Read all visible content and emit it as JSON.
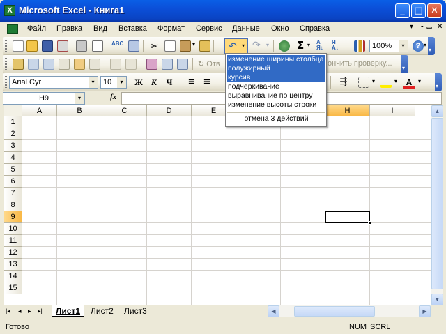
{
  "window": {
    "title": "Microsoft Excel - Книга1",
    "icon_label": "X",
    "minimize": "_",
    "maximize": "□",
    "close": "✕"
  },
  "menu": {
    "items": [
      "Файл",
      "Правка",
      "Вид",
      "Вставка",
      "Формат",
      "Сервис",
      "Данные",
      "Окно",
      "Справка"
    ],
    "doc_controls": [
      "▾",
      "-",
      "ꟷ",
      "✕"
    ]
  },
  "standard_toolbar": {
    "zoom": "100%",
    "icons": [
      "new-icon",
      "open-icon",
      "save-icon",
      "permission-icon",
      "print-icon",
      "print-preview-icon",
      "spelling-icon",
      "research-icon",
      "cut-icon",
      "copy-icon",
      "paste-icon",
      "format-painter-icon",
      "undo-icon",
      "redo-icon",
      "hyperlink-icon",
      "autosum-icon",
      "sort-ascending-icon",
      "sort-descending-icon",
      "chart-wizard-icon",
      "help-icon"
    ],
    "autosum": "Σ"
  },
  "reviewing_toolbar": {
    "reply_label": "Отв",
    "end_review_label": "ончить проверку..."
  },
  "formatting_toolbar": {
    "font": "Arial Cyr",
    "size": "10",
    "bold": "Ж",
    "italic": "К",
    "underline": "Ч"
  },
  "formula_bar": {
    "name_box": "H9",
    "fx": "fx",
    "formula": ""
  },
  "grid": {
    "columns": [
      "A",
      "B",
      "C",
      "D",
      "E",
      "F",
      "G",
      "H",
      "I"
    ],
    "rows": [
      "1",
      "2",
      "3",
      "4",
      "5",
      "6",
      "7",
      "8",
      "9",
      "10",
      "11",
      "12",
      "13",
      "14",
      "15"
    ],
    "selected_column": "H",
    "selected_row": "9"
  },
  "undo_dropdown": {
    "items": [
      {
        "label": "изменение ширины столбца",
        "selected": true
      },
      {
        "label": "полужирный",
        "selected": true
      },
      {
        "label": "курсив",
        "selected": true
      },
      {
        "label": "подчеркивание",
        "selected": false
      },
      {
        "label": "выравнивание по центру",
        "selected": false
      },
      {
        "label": "изменение высоты строки",
        "selected": false
      }
    ],
    "footer": "отмена 3 действий"
  },
  "sheets": {
    "tabs": [
      "Лист1",
      "Лист2",
      "Лист3"
    ],
    "active": "Лист1",
    "nav": [
      "|◂",
      "◂",
      "▸",
      "▸|"
    ]
  },
  "status_bar": {
    "status": "Готово",
    "num": "NUM",
    "scrl": "SCRL"
  }
}
